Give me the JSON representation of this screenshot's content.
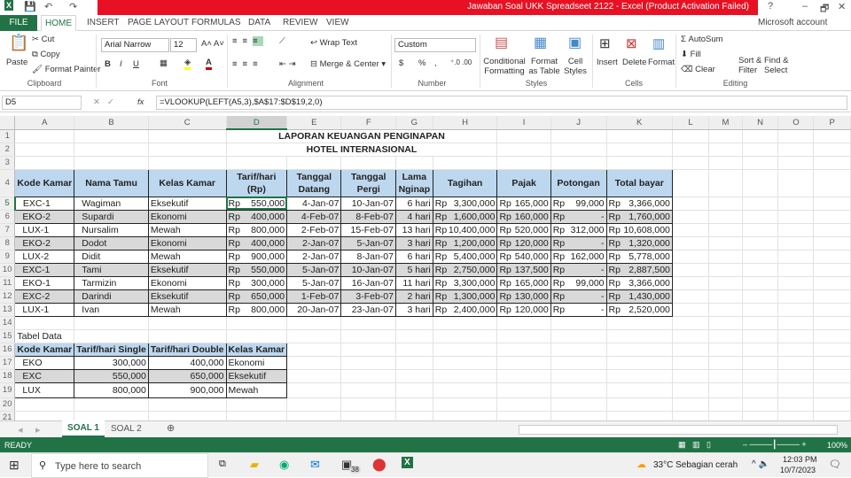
{
  "window": {
    "title": "Jawaban Soal UKK Spreadseet 2122 -  Excel (Product Activation Failed)",
    "account": "Microsoft account",
    "help": "?",
    "minimize": "–",
    "restore": "🗗",
    "close": "✕"
  },
  "tabs": [
    "FILE",
    "HOME",
    "INSERT",
    "PAGE LAYOUT",
    "FORMULAS",
    "DATA",
    "REVIEW",
    "VIEW"
  ],
  "ribbon": {
    "paste": "Paste",
    "cut": "Cut",
    "copy": "Copy",
    "format_painter": "Format Painter",
    "clipboard": "Clipboard",
    "font_name": "Arial Narrow",
    "font_size": "12",
    "font": "Font",
    "bold": "B",
    "italic": "I",
    "underline": "U",
    "wrap_text": "Wrap Text",
    "merge_center": "Merge & Center",
    "alignment": "Alignment",
    "number_format": "Custom",
    "currency": "$",
    "percent": "%",
    "comma": ",",
    "number": "Number",
    "conditional": "Conditional Formatting",
    "format_table": "Format as Table",
    "cell_styles": "Cell Styles",
    "styles": "Styles",
    "insert": "Insert",
    "delete": "Delete",
    "format": "Format",
    "cells": "Cells",
    "autosum": "AutoSum",
    "fill": "Fill",
    "clear": "Clear",
    "sort_filter": "Sort & Filter",
    "find_select": "Find & Select",
    "editing": "Editing"
  },
  "formula_bar": {
    "name_box": "D5",
    "fx": "fx",
    "formula": "=VLOOKUP(LEFT(A5,3),$A$17:$D$19,2,0)"
  },
  "columns": [
    "A",
    "B",
    "C",
    "D",
    "E",
    "F",
    "G",
    "H",
    "I",
    "J",
    "K",
    "L",
    "M",
    "N",
    "O",
    "P"
  ],
  "sheet": {
    "title1": "LAPORAN  KEUANGAN PENGINAPAN",
    "title2": "HOTEL INTERNASIONAL",
    "headers": [
      "Kode Kamar",
      "Nama Tamu",
      "Kelas Kamar",
      "Tarif/hari (Rp)",
      "Tanggal Datang",
      "Tanggal Pergi",
      "Lama Nginap",
      "Tagihan",
      "Pajak",
      "Potongan",
      "Total bayar"
    ],
    "currency": "Rp",
    "rows": [
      [
        "EXC-1",
        "Wagiman",
        "Eksekutif",
        "550,000",
        "4-Jan-07",
        "10-Jan-07",
        "6 hari",
        "3,300,000",
        "165,000",
        "99,000",
        "3,366,000"
      ],
      [
        "EKO-2",
        "Supardi",
        "Ekonomi",
        "400,000",
        "4-Feb-07",
        "8-Feb-07",
        "4 hari",
        "1,600,000",
        "160,000",
        "-",
        "1,760,000"
      ],
      [
        "LUX-1",
        "Nursalim",
        "Mewah",
        "800,000",
        "2-Feb-07",
        "15-Feb-07",
        "13 hari",
        "10,400,000",
        "520,000",
        "312,000",
        "10,608,000"
      ],
      [
        "EKO-2",
        "Dodot",
        "Ekonomi",
        "400,000",
        "2-Jan-07",
        "5-Jan-07",
        "3 hari",
        "1,200,000",
        "120,000",
        "-",
        "1,320,000"
      ],
      [
        "LUX-2",
        "Didit",
        "Mewah",
        "900,000",
        "2-Jan-07",
        "8-Jan-07",
        "6 hari",
        "5,400,000",
        "540,000",
        "162,000",
        "5,778,000"
      ],
      [
        "EXC-1",
        "Tami",
        "Eksekutif",
        "550,000",
        "5-Jan-07",
        "10-Jan-07",
        "5 hari",
        "2,750,000",
        "137,500",
        "-",
        "2,887,500"
      ],
      [
        "EKO-1",
        "Tarmizin",
        "Ekonomi",
        "300,000",
        "5-Jan-07",
        "16-Jan-07",
        "11 hari",
        "3,300,000",
        "165,000",
        "99,000",
        "3,366,000"
      ],
      [
        "EXC-2",
        "Darindi",
        "Eksekutif",
        "650,000",
        "1-Feb-07",
        "3-Feb-07",
        "2 hari",
        "1,300,000",
        "130,000",
        "-",
        "1,430,000"
      ],
      [
        "LUX-1",
        "Ivan",
        "Mewah",
        "800,000",
        "20-Jan-07",
        "23-Jan-07",
        "3 hari",
        "2,400,000",
        "120,000",
        "-",
        "2,520,000"
      ]
    ],
    "data_label": "Tabel Data",
    "data_headers": [
      "Kode Kamar",
      "Tarif/hari Single",
      "Tarif/hari Double",
      "Kelas Kamar"
    ],
    "data_rows": [
      [
        "EKO",
        "300,000",
        "400,000",
        "Ekonomi"
      ],
      [
        "EXC",
        "550,000",
        "650,000",
        "Eksekutif"
      ],
      [
        "LUX",
        "800,000",
        "900,000",
        "Mewah"
      ]
    ]
  },
  "sheet_tabs": [
    "SOAL 1",
    "SOAL 2"
  ],
  "status": {
    "ready": "READY",
    "zoom": "100%"
  },
  "taskbar": {
    "search": "Type here to search",
    "weather": "33°C  Sebagian cerah",
    "time": "12:03 PM",
    "date": "10/7/2023",
    "mail_badge": "38"
  }
}
